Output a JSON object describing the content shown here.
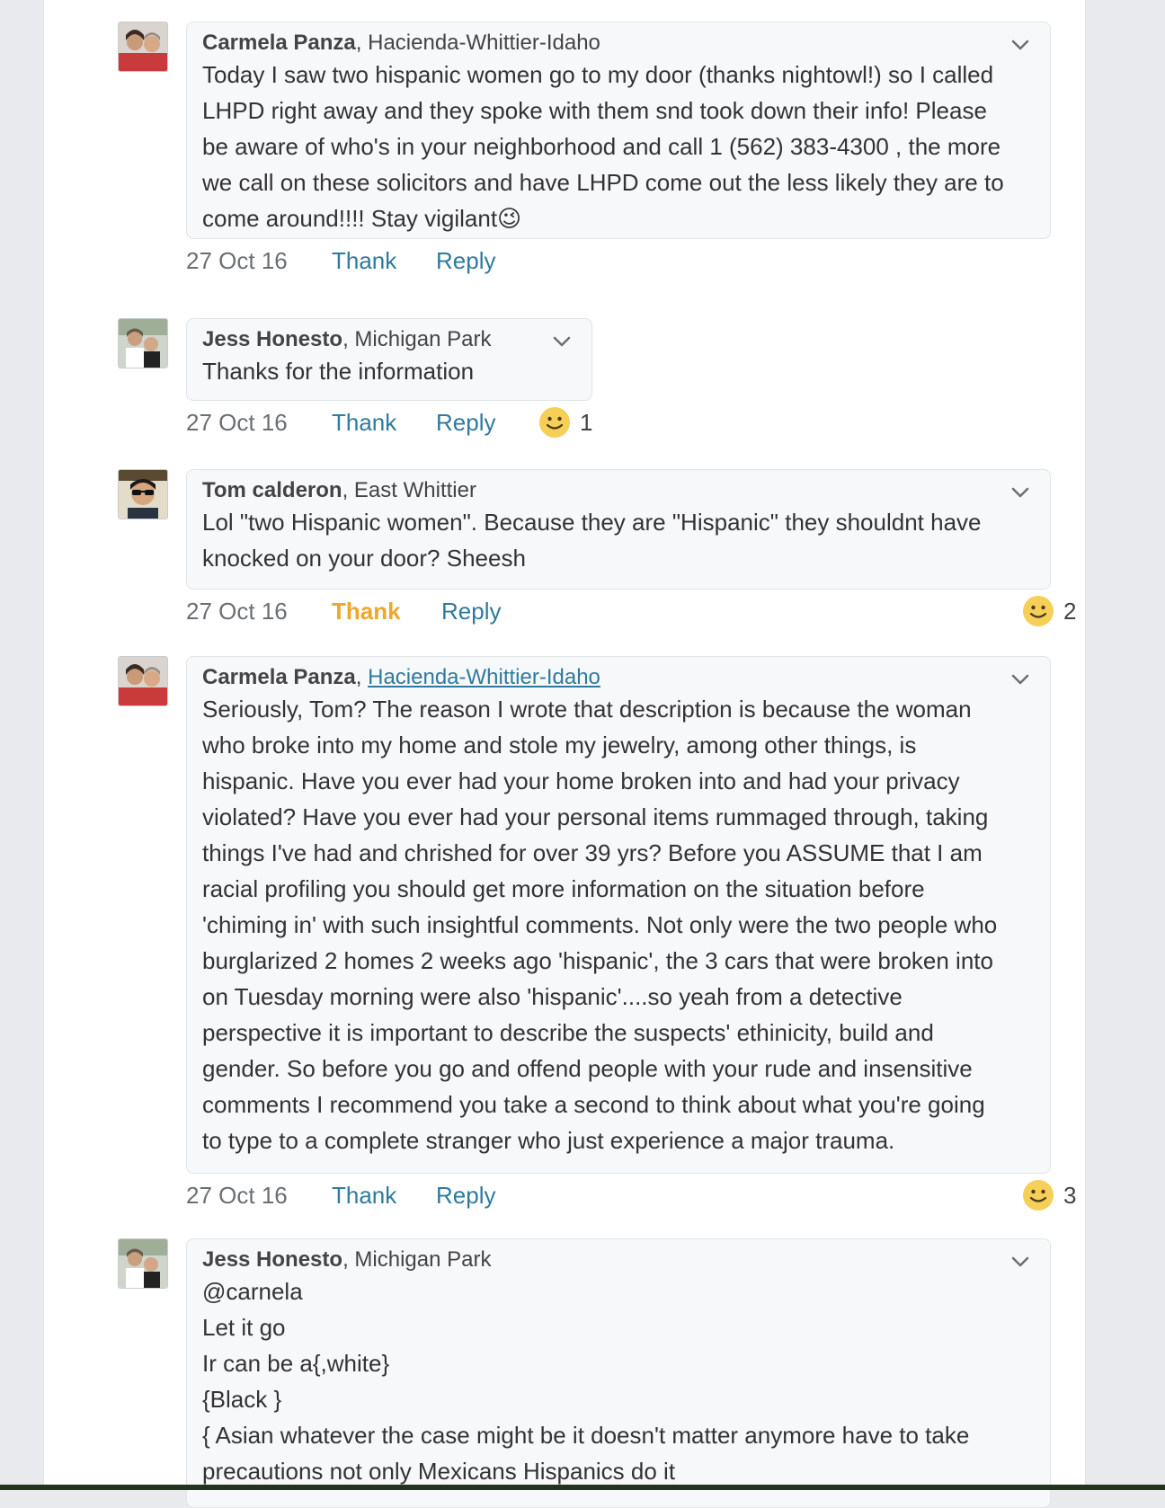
{
  "comments": [
    {
      "author": "Carmela Panza",
      "location": "Hacienda-Whittier-Idaho",
      "lines": [
        "Today I saw two hispanic women go to my door (thanks nightowl!) so I called",
        "LHPD right away and they spoke with them snd took down their info! Please",
        "be aware of who's in your neighborhood and call 1 (562) 383-4300 , the more",
        "we call on these solicitors and have LHPD come out the less likely they are to",
        "come around!!!! Stay vigilant😉"
      ],
      "date": "27 Oct 16",
      "thank": "Thank",
      "reply": "Reply"
    },
    {
      "author": "Jess Honesto",
      "location": "Michigan Park",
      "lines": [
        "Thanks for the information"
      ],
      "date": "27 Oct 16",
      "thank": "Thank",
      "reply": "Reply",
      "reaction_count": "1"
    },
    {
      "author": "Tom calderon",
      "location": "East Whittier",
      "lines": [
        "Lol \"two Hispanic women\". Because they are  \"Hispanic\" they shouldnt have",
        "knocked on your door? Sheesh"
      ],
      "date": "27 Oct 16",
      "thank": "Thank",
      "reply": "Reply",
      "reaction_count": "2"
    },
    {
      "author": "Carmela Panza",
      "location": "Hacienda-Whittier-Idaho",
      "lines": [
        "Seriously, Tom? The reason I wrote that description is because the woman",
        "who broke into my home and stole my jewelry,  among other things, is",
        "hispanic. Have you ever had your home broken into and had your privacy",
        "violated? Have  you ever had your personal items rummaged through, taking",
        "things I've had and chrished for over 39 yrs? Before you ASSUME that I am",
        "racial profiling you should get more information on the situation before",
        "'chiming in' with such insightful comments. Not only were the two people who",
        "burglarized 2 homes 2 weeks ago 'hispanic', the 3 cars that were broken into",
        "on Tuesday morning were also 'hispanic'....so yeah from a detective",
        "perspective it is important to describe the suspects' ethinicity, build and",
        "gender. So before you go and offend people with your rude and insensitive",
        "comments I recommend you take a second to think about what you're going",
        "to type to a complete stranger who just experience a major trauma."
      ],
      "date": "27 Oct 16",
      "thank": "Thank",
      "reply": "Reply",
      "reaction_count": "3"
    },
    {
      "author": "Jess Honesto",
      "location": "Michigan Park",
      "lines": [
        "@carnela",
        "Let it go",
        "Ir can be a{,white}",
        "{Black }",
        "{ Asian whatever the case might be it doesn't matter anymore have to take",
        "precautions not only Mexicans Hispanics do it"
      ]
    }
  ],
  "icons": {
    "menu": "chevron-down-icon",
    "reaction": "smiley-icon"
  },
  "colors": {
    "link": "#2f7a9d",
    "thanked": "#f0a62b",
    "bubble_bg": "#f7f8fa",
    "smiley": "#f5cf57"
  }
}
